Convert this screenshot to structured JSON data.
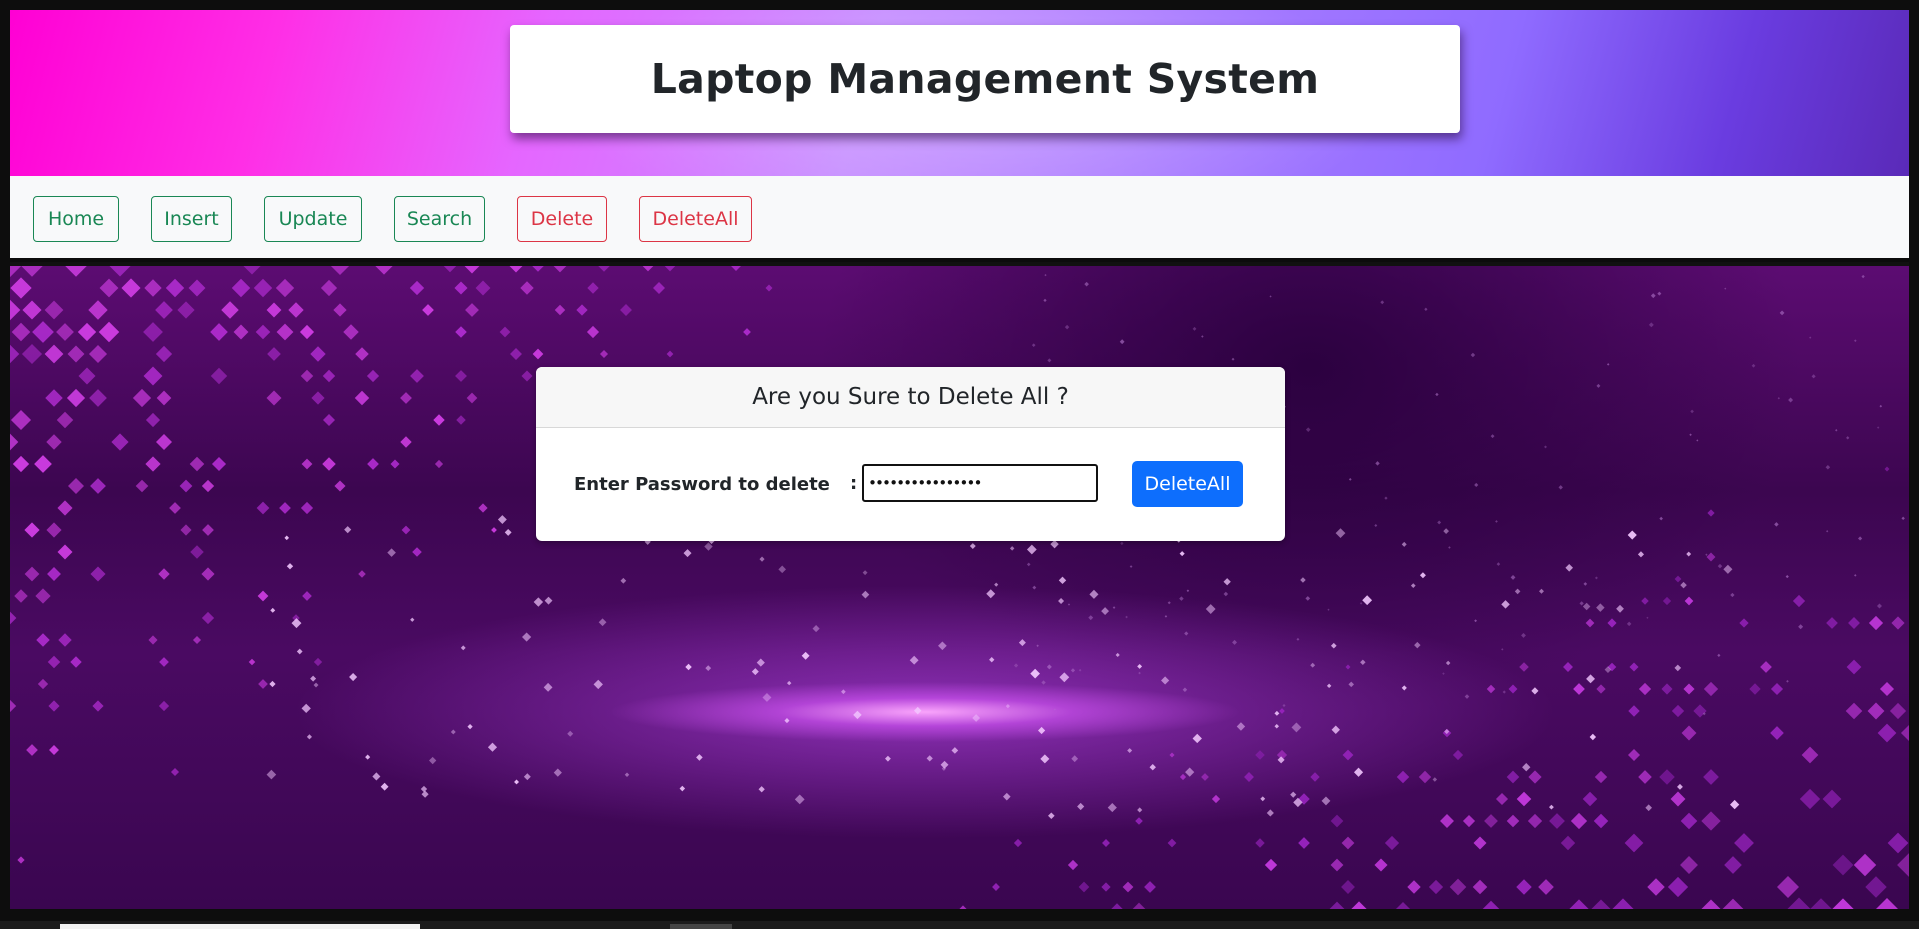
{
  "header": {
    "title": "Laptop Management System"
  },
  "nav": {
    "items": [
      {
        "label": "Home",
        "variant": "success"
      },
      {
        "label": "Insert",
        "variant": "success"
      },
      {
        "label": "Update",
        "variant": "success"
      },
      {
        "label": "Search",
        "variant": "success"
      },
      {
        "label": "Delete",
        "variant": "danger"
      },
      {
        "label": "DeleteAll",
        "variant": "danger"
      }
    ]
  },
  "confirm": {
    "heading": "Are you Sure to Delete All ?",
    "password_label": "Enter Password to delete",
    "separator": ":",
    "password_value": "••••••••••••••••",
    "button_label": "DeleteAll"
  },
  "colors": {
    "success": "#198754",
    "danger": "#dc3545",
    "primary": "#0d6efd",
    "nav_bg": "#f8f9fa",
    "header_gradient_start": "#ff00d4",
    "header_gradient_end": "#5a2ab8",
    "background_purple": "#4a0a62"
  }
}
